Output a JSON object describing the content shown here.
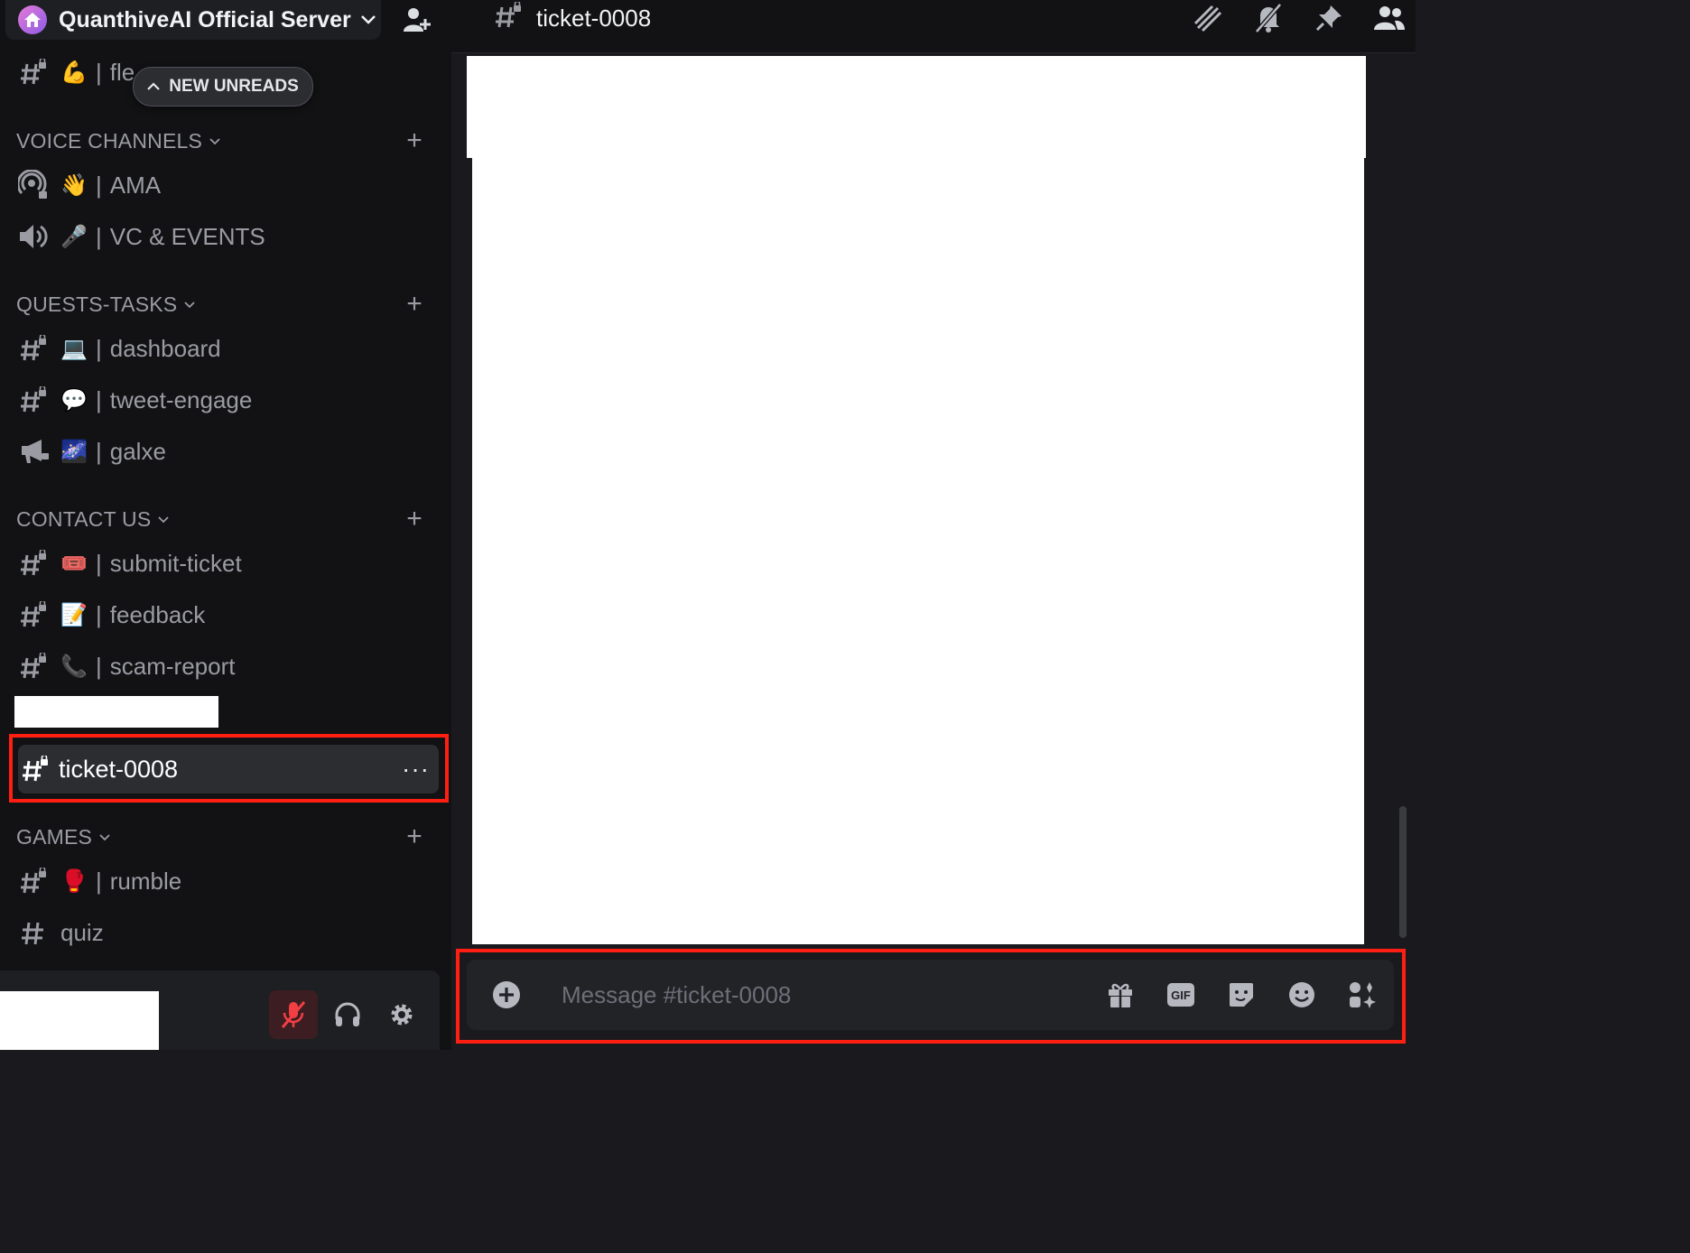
{
  "server": {
    "name": "QuanthiveAI Official Server"
  },
  "new_unreads": "NEW UNREADS",
  "partial_channel": {
    "emoji": "💪",
    "name": "fle"
  },
  "categories": {
    "voice": {
      "label": "VOICE CHANNELS"
    },
    "quests": {
      "label": "QUESTS-TASKS"
    },
    "contact": {
      "label": "CONTACT US"
    },
    "games": {
      "label": "GAMES"
    }
  },
  "channels": {
    "ama": {
      "emoji": "👋",
      "name": "AMA"
    },
    "vc_events": {
      "emoji": "🎤",
      "name": "VC & EVENTS"
    },
    "dashboard": {
      "emoji": "💻",
      "name": "dashboard"
    },
    "tweet_engage": {
      "emoji": "💬",
      "name": "tweet-engage"
    },
    "galxe": {
      "emoji": "🌌",
      "name": "galxe"
    },
    "submit_ticket": {
      "emoji": "🎟️",
      "name": "submit-ticket"
    },
    "feedback": {
      "emoji": "📝",
      "name": "feedback"
    },
    "scam_report": {
      "emoji": "📞",
      "name": "scam-report"
    },
    "rumble": {
      "emoji": "🥊",
      "name": "rumble"
    },
    "quiz": {
      "name": "quiz"
    }
  },
  "selected_channel": {
    "name": "ticket-0008",
    "more": "···"
  },
  "pipe": "|",
  "header": {
    "channel_name": "ticket-0008"
  },
  "composer": {
    "placeholder": "Message #ticket-0008",
    "gif_label": "GIF"
  },
  "colors": {
    "highlight": "#ff1f12",
    "sidebar_bg": "#121214",
    "selected_bg": "#2b2d31"
  }
}
